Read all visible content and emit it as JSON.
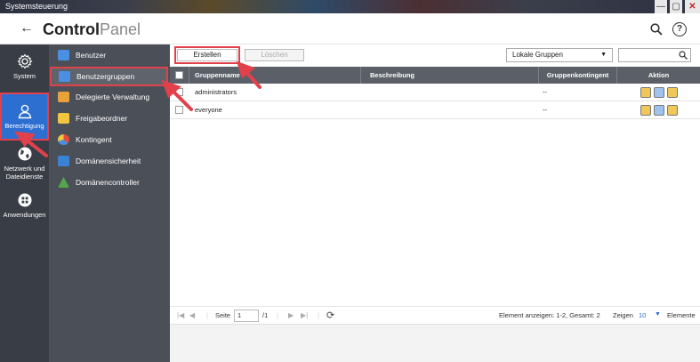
{
  "window": {
    "title": "Systemsteuerung",
    "minimize": "—",
    "maximize": "▢",
    "close": "✕"
  },
  "header": {
    "title_bold": "Control",
    "title_light": "Panel",
    "back_icon": "arrow-left-icon",
    "help": "?"
  },
  "leftnav": {
    "items": [
      {
        "label": "System",
        "icon": "gear-icon"
      },
      {
        "label": "Berechtigung",
        "icon": "user-icon"
      },
      {
        "label": "Netzwerk und Dateidienste",
        "icon": "globe-icon"
      },
      {
        "label": "Anwendungen",
        "icon": "apps-icon"
      }
    ]
  },
  "subnav": {
    "items": [
      {
        "label": "Benutzer",
        "color": "#4a8fe3"
      },
      {
        "label": "Benutzergruppen",
        "color": "#4a8fe3"
      },
      {
        "label": "Delegierte Verwaltung",
        "color": "#e9a23b"
      },
      {
        "label": "Freigabeordner",
        "color": "#f2c440"
      },
      {
        "label": "Kontingent",
        "color": "#e24c3c"
      },
      {
        "label": "Domänensicherheit",
        "color": "#3b82d6"
      },
      {
        "label": "Domänencontroller",
        "color": "#55a64a"
      }
    ]
  },
  "toolbar": {
    "create_label": "Erstellen",
    "delete_label": "Löschen",
    "filter_value": "Lokale Gruppen"
  },
  "table": {
    "headers": [
      "Gruppenname",
      "Beschreibung",
      "Gruppenkontingent",
      "Aktion"
    ],
    "rows": [
      {
        "name": "administrators",
        "description": "",
        "quota": "--"
      },
      {
        "name": "everyone",
        "description": "",
        "quota": "--"
      }
    ]
  },
  "footer": {
    "page_label": "Seite",
    "page_value": "1",
    "page_total": "/1",
    "summary": "Element anzeigen: 1-2, Gesamt: 2",
    "show_label": "Zeigen",
    "show_value": "10",
    "items_label": "Elemente"
  },
  "colors": {
    "accent": "#2c6fd1",
    "highlight": "#e1414b",
    "nav_bg": "#393d45",
    "subnav_bg": "#4b4f58",
    "table_head": "#5b6068"
  }
}
